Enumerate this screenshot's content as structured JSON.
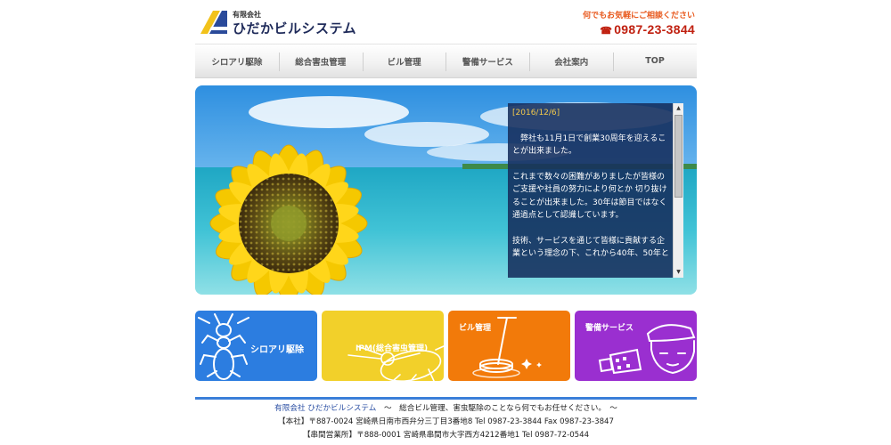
{
  "header": {
    "logo_small": "有限会社",
    "logo_name": "ひだかビルシステム",
    "contact_message": "何でもお気軽にご相談ください",
    "phone_icon": "☎",
    "phone": "0987-23-3844"
  },
  "nav": {
    "items": [
      "シロアリ駆除",
      "総合害虫管理",
      "ビル管理",
      "警備サービス",
      "会社案内",
      "TOP"
    ]
  },
  "news": {
    "date": "[2016/12/6]",
    "paragraphs": [
      "　弊社も11月1日で創業30周年を迎えることが出来ました。",
      "これまで数々の困難がありましたが皆様のご支援や社員の努力により何とか 切り抜けることが出来ました。30年は節目ではなく通過点として認識しています。",
      "技術、サービスを通じて皆様に貢献する企業という理念の下、これから40年、50年と"
    ]
  },
  "tiles": [
    {
      "label": "シロアリ駆除",
      "color": "#2c7de0",
      "icon": "termite-icon"
    },
    {
      "label": "IPM(総合害虫管理)",
      "color": "#f2d02a",
      "icon": "cockroach-icon"
    },
    {
      "label": "ビル管理",
      "color": "#f27a0a",
      "icon": "floor-polisher-icon"
    },
    {
      "label": "警備サービス",
      "color": "#9a2fd0",
      "icon": "security-guard-icon"
    }
  ],
  "footer": {
    "line1_company": "有限会社 ひだかビルシステム",
    "line1_rest": "　～　総合ビル管理、害虫駆除のことなら何でもお任せください。　～",
    "line2": "【本社】〒887-0024  宮崎県日南市西弁分三丁目3番地8  Tel 0987-23-3844  Fax 0987-23-3847",
    "line3": "【串間営業所】〒888-0001  宮崎県串間市大字西方4212番地1  Tel 0987-72-0544"
  },
  "colors": {
    "nav_text": "#555555",
    "accent_blue": "#3b7fd9",
    "contact_orange": "#e8581c",
    "phone_red": "#c02010"
  }
}
